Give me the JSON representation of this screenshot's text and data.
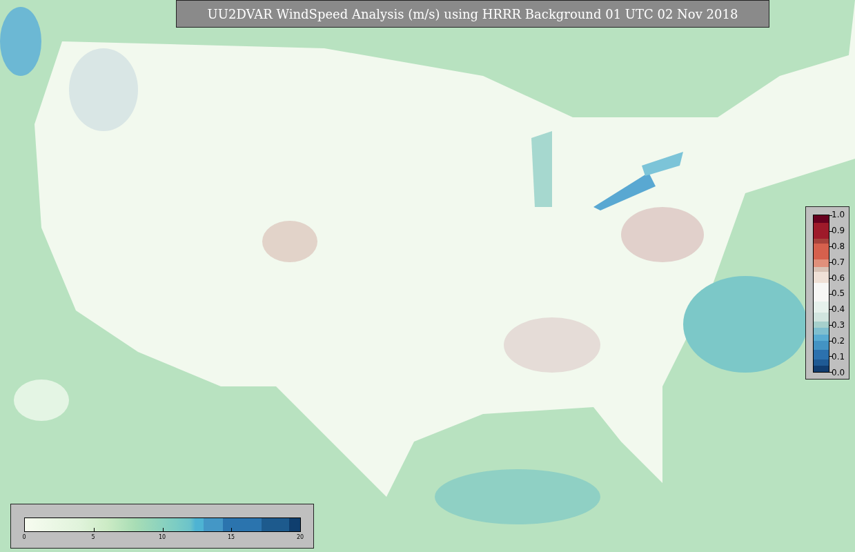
{
  "title": "UU2DVAR WindSpeed Analysis (m/s) using HRRR Background 01 UTC 02 Nov 2018",
  "vertical_colorbar": {
    "ticks": [
      "1.0",
      "0.9",
      "0.8",
      "0.7",
      "0.6",
      "0.5",
      "0.4",
      "0.3",
      "0.2",
      "0.1",
      "0.0"
    ]
  },
  "horizontal_colorbar": {
    "ticks": [
      "0",
      "5",
      "10",
      "15",
      "20"
    ]
  }
}
